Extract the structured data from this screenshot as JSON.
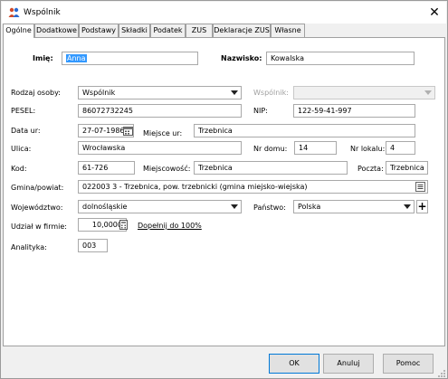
{
  "window": {
    "title": "Wspólnik",
    "icon": "people-icon",
    "close_label": "✕"
  },
  "tabs": [
    "Ogólne",
    "Dodatkowe",
    "Podstawy",
    "Składki",
    "Podatek",
    "ZUS",
    "Deklaracje ZUS",
    "Własne"
  ],
  "active_tab": "Ogólne",
  "form": {
    "imie_label": "Imię:",
    "imie_value": "Anna",
    "nazwisko_label": "Nazwisko:",
    "nazwisko_value": "Kowalska",
    "rodzaj_label": "Rodzaj osoby:",
    "rodzaj_value": "Wspólnik",
    "wspolnik_label": "Wspólnik:",
    "wspolnik_value": "",
    "pesel_label": "PESEL:",
    "pesel_value": "86072732245",
    "nip_label": "NIP:",
    "nip_value": "122-59-41-997",
    "data_ur_label": "Data ur:",
    "data_ur_value": "27-07-1986",
    "miejsce_ur_label": "Miejsce ur:",
    "miejsce_ur_value": "Trzebnica",
    "ulica_label": "Ulica:",
    "ulica_value": "Wrocławska",
    "nr_domu_label": "Nr domu:",
    "nr_domu_value": "14",
    "nr_lokalu_label": "Nr lokalu:",
    "nr_lokalu_value": "4",
    "kod_label": "Kod:",
    "kod_value": "61-726",
    "miejscowosc_label": "Miejscowość:",
    "miejscowosc_value": "Trzebnica",
    "poczta_label": "Poczta:",
    "poczta_value": "Trzebnica",
    "gmina_label": "Gmina/powiat:",
    "gmina_value": "022003 3 - Trzebnica, pow. trzebnicki (gmina miejsko-wiejska)",
    "wojewodztwo_label": "Województwo:",
    "wojewodztwo_value": "dolnośląskie",
    "panstwo_label": "Państwo:",
    "panstwo_value": "Polska",
    "panstwo_add": "+",
    "udzial_label": "Udział w firmie:",
    "udzial_value": "10,0000",
    "dopelnij_link": "Dopełnij do 100%",
    "analityka_label": "Analityka:",
    "analityka_value": "003"
  },
  "buttons": {
    "ok": "OK",
    "anuluj": "Anuluj",
    "pomoc": "Pomoc"
  },
  "colors": {
    "selection": "#3399ff",
    "default_button_border": "#0078d7"
  }
}
